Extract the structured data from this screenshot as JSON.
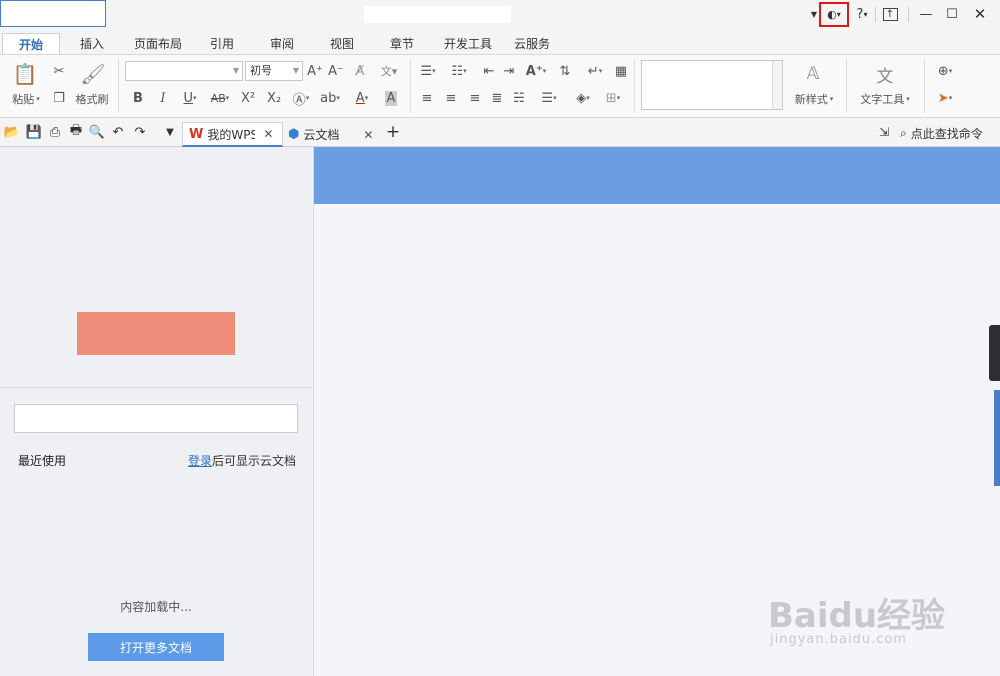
{
  "titlebar": {
    "help_label": "?",
    "min_glyph": "—",
    "max_glyph": "☐",
    "close_glyph": "✕"
  },
  "ribbon_tabs": [
    {
      "label": "开始",
      "active": true
    },
    {
      "label": "插入"
    },
    {
      "label": "页面布局"
    },
    {
      "label": "引用"
    },
    {
      "label": "审阅"
    },
    {
      "label": "视图"
    },
    {
      "label": "章节"
    },
    {
      "label": "开发工具"
    },
    {
      "label": "云服务"
    }
  ],
  "ribbon": {
    "paste_label": "粘贴",
    "format_painter_label": "格式刷",
    "font_size_value": "初号",
    "new_style_label": "新样式",
    "text_tools_label": "文字工具",
    "bold": "B",
    "italic": "I",
    "underline": "U",
    "strike": "AB",
    "superscript": "X²",
    "subscript": "X₂",
    "font_color": "A"
  },
  "doc_tabs": [
    {
      "label": "我的WPS",
      "active": true
    },
    {
      "label": "云文档"
    }
  ],
  "find_command": "点此查找命令",
  "left_panel": {
    "recent_label": "最近使用",
    "login_link": "登录",
    "login_hint_rest": "后可显示云文档",
    "loading_text": "内容加载中...",
    "open_more_button": "打开更多文档"
  },
  "watermark": {
    "logo": "Baidu经验",
    "subtitle": "jingyan.baidu.com"
  },
  "colors": {
    "accent": "#4a7fc8",
    "banner": "#6a9ee0",
    "highlight_box": "#e0161b",
    "placeholder_block": "#ef8d7b",
    "open_button": "#5b9be8"
  }
}
